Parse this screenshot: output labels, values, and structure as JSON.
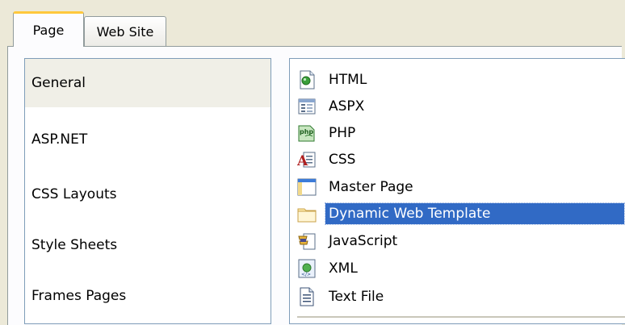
{
  "tabs": [
    {
      "label": "Page",
      "selected": true
    },
    {
      "label": "Web Site",
      "selected": false
    }
  ],
  "categories": [
    {
      "label": "General",
      "selected": true
    },
    {
      "label": "ASP.NET",
      "selected": false
    },
    {
      "label": "CSS Layouts",
      "selected": false
    },
    {
      "label": "Style Sheets",
      "selected": false
    },
    {
      "label": "Frames Pages",
      "selected": false
    }
  ],
  "page_types": [
    {
      "label": "HTML",
      "icon": "html-page-icon"
    },
    {
      "label": "ASPX",
      "icon": "aspx-page-icon"
    },
    {
      "label": "PHP",
      "icon": "php-page-icon"
    },
    {
      "label": "CSS",
      "icon": "css-page-icon"
    },
    {
      "label": "Master Page",
      "icon": "master-page-icon"
    },
    {
      "label": "Dynamic Web Template",
      "icon": "folder-icon",
      "selected": true
    },
    {
      "label": "JavaScript",
      "icon": "javascript-icon"
    },
    {
      "label": "XML",
      "icon": "xml-page-icon"
    },
    {
      "label": "Text File",
      "icon": "text-file-icon"
    }
  ],
  "colors": {
    "selection": "#316ac5",
    "category_selected_bg": "#f0efe7",
    "tab_accent": "#ffc83c",
    "dialog_bg": "#ece9d8"
  }
}
